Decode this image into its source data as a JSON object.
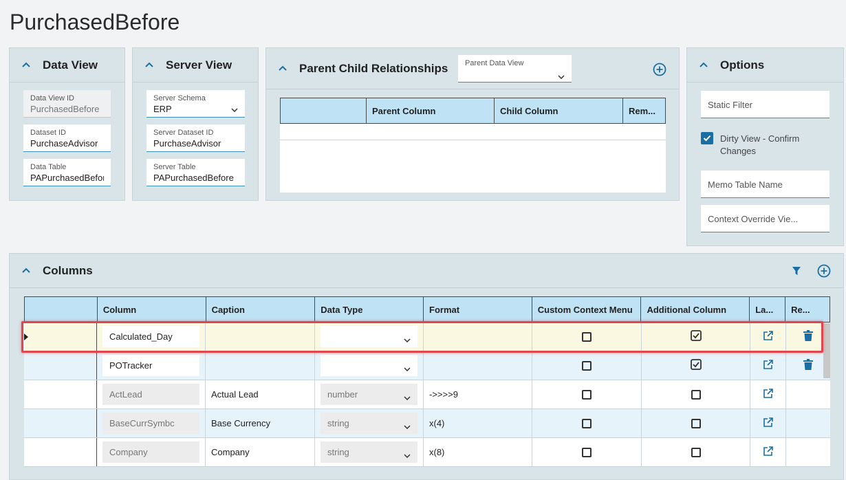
{
  "page": {
    "title": "PurchasedBefore"
  },
  "data_view_panel": {
    "title": "Data View",
    "fields": [
      {
        "label": "Data View ID",
        "value": "PurchasedBefore"
      },
      {
        "label": "Dataset ID",
        "value": "PurchaseAdvisor"
      },
      {
        "label": "Data Table",
        "value": "PAPurchasedBefore"
      }
    ]
  },
  "server_view_panel": {
    "title": "Server View",
    "fields": [
      {
        "label": "Server Schema",
        "value": "ERP"
      },
      {
        "label": "Server Dataset ID",
        "value": "PurchaseAdvisor"
      },
      {
        "label": "Server Table",
        "value": "PAPurchasedBefore"
      }
    ]
  },
  "relationships_panel": {
    "title": "Parent Child Relationships",
    "parent_data_view_label": "Parent Data View",
    "parent_data_view_value": "",
    "columns": [
      "",
      "Parent Column",
      "Child Column",
      "Rem..."
    ]
  },
  "options_panel": {
    "title": "Options",
    "static_filter_placeholder": "Static Filter",
    "dirty_view_label": "Dirty View - Confirm Changes",
    "dirty_view_checked": true,
    "memo_table_placeholder": "Memo Table Name",
    "context_override_placeholder": "Context Override Vie..."
  },
  "columns_panel": {
    "title": "Columns",
    "headers": [
      "",
      "Column",
      "Caption",
      "Data Type",
      "Format",
      "Custom Context Menu",
      "Additional Column",
      "La...",
      "Re..."
    ],
    "rows": [
      {
        "column": "Calculated_Day",
        "caption": "",
        "data_type": "",
        "format": "",
        "custom_context_menu": false,
        "additional_column": true,
        "editable": true,
        "removable": true,
        "selected": true
      },
      {
        "column": "POTracker",
        "caption": "",
        "data_type": "",
        "format": "",
        "custom_context_menu": false,
        "additional_column": true,
        "editable": true,
        "removable": true,
        "selected": false
      },
      {
        "column": "ActLead",
        "caption": "Actual Lead",
        "data_type": "number",
        "format": "->>>>9",
        "custom_context_menu": false,
        "additional_column": false,
        "editable": false,
        "removable": false,
        "selected": false
      },
      {
        "column": "BaseCurrSymbc",
        "caption": "Base Currency",
        "data_type": "string",
        "format": "x(4)",
        "custom_context_menu": false,
        "additional_column": false,
        "editable": false,
        "removable": false,
        "selected": false
      },
      {
        "column": "Company",
        "caption": "Company",
        "data_type": "string",
        "format": "x(8)",
        "custom_context_menu": false,
        "additional_column": false,
        "editable": false,
        "removable": false,
        "selected": false
      }
    ]
  },
  "colors": {
    "accent": "#1a6ea3",
    "panel_bg": "#d8e4e8",
    "header_bg": "#bfe3f5",
    "selected_row_bg": "#fbf8e1",
    "highlight_border": "#e0464e"
  },
  "icons": [
    "chevron-up-icon",
    "chevron-down-icon",
    "add-circle-icon",
    "filter-icon",
    "external-link-icon",
    "trash-icon",
    "checkbox-icon"
  ]
}
